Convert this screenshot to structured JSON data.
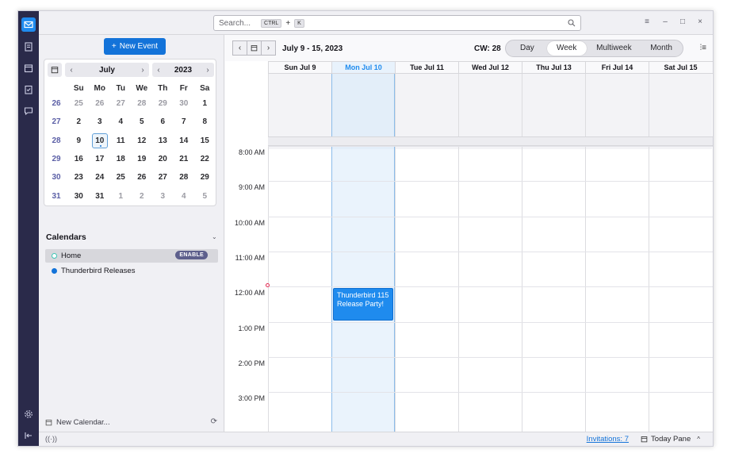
{
  "titlebar": {
    "search_placeholder": "Search...",
    "shortcut_key1": "CTRL",
    "shortcut_plus": "+",
    "shortcut_key2": "K",
    "menu_glyph": "≡",
    "minimize_glyph": "–",
    "maximize_glyph": "□",
    "close_glyph": "×"
  },
  "spaces": [
    "mail-icon",
    "address-book-icon",
    "calendar-icon",
    "tasks-icon",
    "chat-icon",
    "settings-icon",
    "collapse-icon"
  ],
  "left": {
    "new_event_label": "New Event",
    "new_event_plus": "+",
    "minimonth": {
      "month": "July",
      "year": "2023",
      "prev": "‹",
      "next": "›",
      "dow": [
        "Su",
        "Mo",
        "Tu",
        "We",
        "Th",
        "Fr",
        "Sa"
      ],
      "weeks": [
        {
          "wk": "26",
          "days": [
            {
              "d": "25",
              "o": true
            },
            {
              "d": "26",
              "o": true
            },
            {
              "d": "27",
              "o": true
            },
            {
              "d": "28",
              "o": true
            },
            {
              "d": "29",
              "o": true
            },
            {
              "d": "30",
              "o": true
            },
            {
              "d": "1",
              "o": false
            }
          ]
        },
        {
          "wk": "27",
          "days": [
            {
              "d": "2",
              "o": false
            },
            {
              "d": "3",
              "o": false
            },
            {
              "d": "4",
              "o": false
            },
            {
              "d": "5",
              "o": false
            },
            {
              "d": "6",
              "o": false
            },
            {
              "d": "7",
              "o": false
            },
            {
              "d": "8",
              "o": false
            }
          ]
        },
        {
          "wk": "28",
          "days": [
            {
              "d": "9",
              "o": false
            },
            {
              "d": "10",
              "o": false,
              "today": true
            },
            {
              "d": "11",
              "o": false
            },
            {
              "d": "12",
              "o": false
            },
            {
              "d": "13",
              "o": false
            },
            {
              "d": "14",
              "o": false
            },
            {
              "d": "15",
              "o": false
            }
          ]
        },
        {
          "wk": "29",
          "days": [
            {
              "d": "16",
              "o": false
            },
            {
              "d": "17",
              "o": false
            },
            {
              "d": "18",
              "o": false
            },
            {
              "d": "19",
              "o": false
            },
            {
              "d": "20",
              "o": false
            },
            {
              "d": "21",
              "o": false
            },
            {
              "d": "22",
              "o": false
            }
          ]
        },
        {
          "wk": "30",
          "days": [
            {
              "d": "23",
              "o": false
            },
            {
              "d": "24",
              "o": false
            },
            {
              "d": "25",
              "o": false
            },
            {
              "d": "26",
              "o": false
            },
            {
              "d": "27",
              "o": false
            },
            {
              "d": "28",
              "o": false
            },
            {
              "d": "29",
              "o": false
            }
          ]
        },
        {
          "wk": "31",
          "days": [
            {
              "d": "30",
              "o": false
            },
            {
              "d": "31",
              "o": false
            },
            {
              "d": "1",
              "o": true
            },
            {
              "d": "2",
              "o": true
            },
            {
              "d": "3",
              "o": true
            },
            {
              "d": "4",
              "o": true
            },
            {
              "d": "5",
              "o": true
            }
          ]
        }
      ]
    },
    "calendars_title": "Calendars",
    "calendars": [
      {
        "name": "Home",
        "badge": "ENABLE",
        "color": "#3ec5b5",
        "hollow": true
      },
      {
        "name": "Thunderbird Releases",
        "badge": "",
        "color": "#1373d9",
        "hollow": false
      }
    ],
    "new_calendar_label": "New Calendar..."
  },
  "toolbar": {
    "prev": "‹",
    "next": "›",
    "range": "July 9 - 15, 2023",
    "cw": "CW: 28",
    "views": [
      "Day",
      "Week",
      "Multiweek",
      "Month"
    ],
    "active_view": "Week"
  },
  "week": {
    "days": [
      "Sun Jul 9",
      "Mon Jul 10",
      "Tue Jul 11",
      "Wed Jul 12",
      "Thu Jul 13",
      "Fri Jul 14",
      "Sat Jul 15"
    ],
    "today_index": 1,
    "hours": [
      "8:00 AM",
      "9:00 AM",
      "10:00 AM",
      "11:00 AM",
      "12:00 AM",
      "1:00 PM",
      "2:00 PM",
      "3:00 PM"
    ],
    "event": {
      "title": "Thunderbird 115 Release Party!",
      "day_index": 1
    }
  },
  "status": {
    "invitations": "Invitations: 7",
    "today_pane": "Today Pane",
    "today_pane_chevron": "^"
  }
}
